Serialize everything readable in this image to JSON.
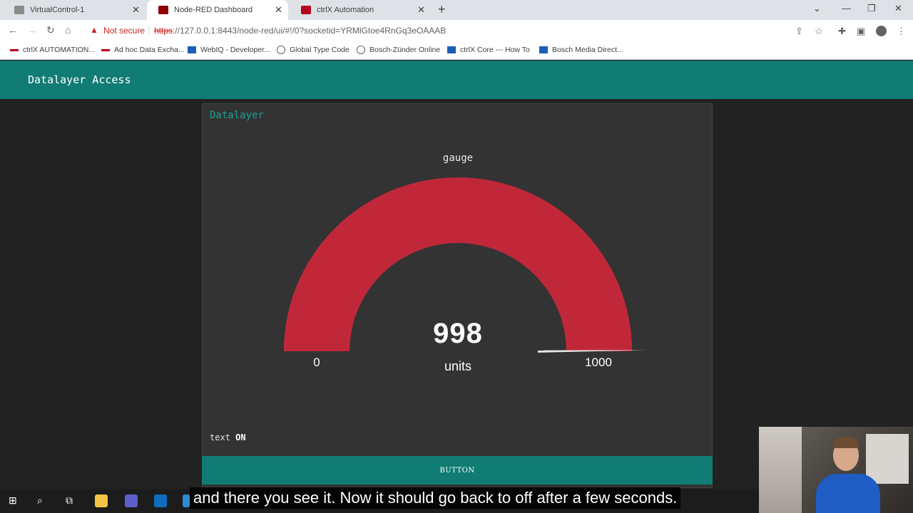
{
  "browser": {
    "tabs": [
      {
        "title": "VirtualControl-1",
        "active": false,
        "favicon_color": "#8a8a8a"
      },
      {
        "title": "Node-RED Dashboard",
        "active": true,
        "favicon_color": "#8f0000"
      },
      {
        "title": "ctrlX Automation",
        "active": false,
        "favicon_color": "#b3001b"
      }
    ],
    "security_label": "Not secure",
    "url_scheme": "https",
    "url_rest": "://127.0.0.1:8443/node-red/ui/#!/0?socketid=YRMlGtoe4RnGq3eOAAAB",
    "bookmarks": [
      {
        "label": "ctrlX AUTOMATION...",
        "icon_color": "#b3001b"
      },
      {
        "label": "Ad hoc Data Excha...",
        "icon_color": "#b3001b"
      },
      {
        "label": "WebIQ - Developer...",
        "icon_color": "#1a5fb4"
      },
      {
        "label": "Global Type Code",
        "icon_color": "#5f6368"
      },
      {
        "label": "Bosch-Zünder Online",
        "icon_color": "#5f6368"
      },
      {
        "label": "ctrlX Core --- How To",
        "icon_color": "#1a5fb4"
      },
      {
        "label": "Bosch Media Direct...",
        "icon_color": "#1a5fb4"
      }
    ]
  },
  "dashboard": {
    "header_title": "Datalayer Access",
    "group_title": "Datalayer",
    "gauge": {
      "label": "gauge",
      "value": "998",
      "units": "units",
      "min": "0",
      "max": "1000",
      "value_num": 998,
      "min_num": 0,
      "max_num": 1000,
      "color": "#c0283a",
      "track_color": "#c0283a"
    },
    "text_label": "text",
    "text_value": "ON",
    "button_label": "BUTTON",
    "accent": "#107c73"
  },
  "subtitle": "and there you see it. Now it should go back to off after a few seconds."
}
